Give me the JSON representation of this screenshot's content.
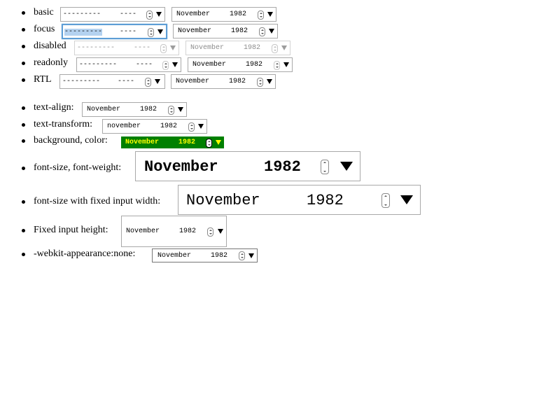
{
  "placeholder": {
    "month": "---------",
    "year": "----"
  },
  "value": {
    "month": "November",
    "year": "1982",
    "month_lower": "november"
  },
  "rows": [
    {
      "id": "basic",
      "label": "basic"
    },
    {
      "id": "focus",
      "label": "focus"
    },
    {
      "id": "disabled",
      "label": "disabled"
    },
    {
      "id": "readonly",
      "label": "readonly"
    },
    {
      "id": "rtl",
      "label": "RTL"
    },
    {
      "id": "text-align",
      "label": "text-align:"
    },
    {
      "id": "text-transform",
      "label": "text-transform:"
    },
    {
      "id": "background-color",
      "label": "background, color:"
    },
    {
      "id": "font-size-weight",
      "label": "font-size, font-weight:"
    },
    {
      "id": "font-size-fixed-width",
      "label": "font-size with fixed input width:"
    },
    {
      "id": "fixed-height",
      "label": "Fixed input height:"
    },
    {
      "id": "appearance-none",
      "label": "-webkit-appearance:none:"
    }
  ],
  "colors": {
    "focus_ring": "#5e9ed6",
    "selection": "#b4d2f0",
    "green_bg": "#008000",
    "yellow_text": "#ffff00"
  },
  "icons": {
    "spin": "spin-buttons-icon",
    "dropdown": "dropdown-arrow-icon"
  }
}
